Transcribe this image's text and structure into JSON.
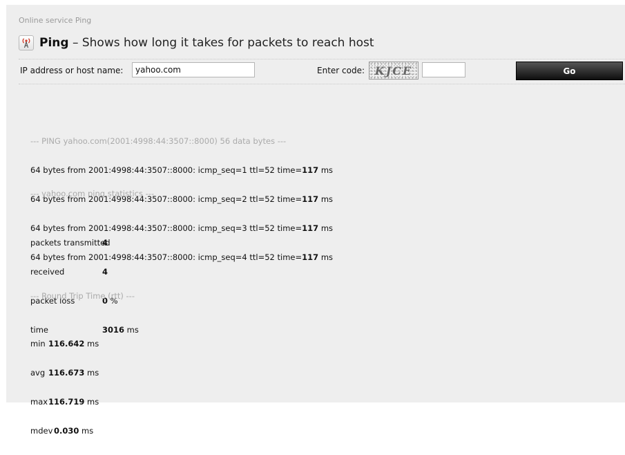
{
  "breadcrumb": "Online service Ping",
  "title": {
    "name": "Ping",
    "rest": " – Shows how long it takes for packets to reach host"
  },
  "form": {
    "ip_label": "IP address or host name:",
    "host_value": "yahoo.com",
    "code_label": "Enter code:",
    "captcha_text": "KJCE",
    "code_value": "",
    "go_label": "Go"
  },
  "ping": {
    "header": "--- PING yahoo.com(2001:4998:44:3507::8000) 56 data bytes ---",
    "lines": [
      {
        "prefix": "64 bytes from 2001:4998:44:3507::8000: icmp_seq=1 ttl=52 time=",
        "time": "117",
        "unit": " ms"
      },
      {
        "prefix": "64 bytes from 2001:4998:44:3507::8000: icmp_seq=2 ttl=52 time=",
        "time": "117",
        "unit": " ms"
      },
      {
        "prefix": "64 bytes from 2001:4998:44:3507::8000: icmp_seq=3 ttl=52 time=",
        "time": "117",
        "unit": " ms"
      },
      {
        "prefix": "64 bytes from 2001:4998:44:3507::8000: icmp_seq=4 ttl=52 time=",
        "time": "117",
        "unit": " ms"
      }
    ]
  },
  "stats": {
    "header": "--- yahoo.com ping statistics ---",
    "rows": [
      {
        "label": "packets transmitted",
        "value": "4",
        "unit": ""
      },
      {
        "label": "received",
        "value": "4",
        "unit": ""
      },
      {
        "label": "packet loss",
        "value": "0",
        "unit": " %"
      },
      {
        "label": "time",
        "value": "3016",
        "unit": " ms"
      }
    ]
  },
  "rtt": {
    "header": "--- Round Trip Time (rtt) ---",
    "rows": [
      {
        "label": "min",
        "value": "116.642",
        "unit": " ms"
      },
      {
        "label": "avg",
        "value": "116.673",
        "unit": " ms"
      },
      {
        "label": "max",
        "value": "116.719",
        "unit": " ms"
      },
      {
        "label": "mdev",
        "value": "0.030",
        "unit": " ms"
      }
    ]
  },
  "colors": {
    "panel_background": "#eeeeee",
    "muted_text": "#aaaaaa",
    "button_dark": "#0e0e0e",
    "icon_accent": "#d23c2a"
  }
}
